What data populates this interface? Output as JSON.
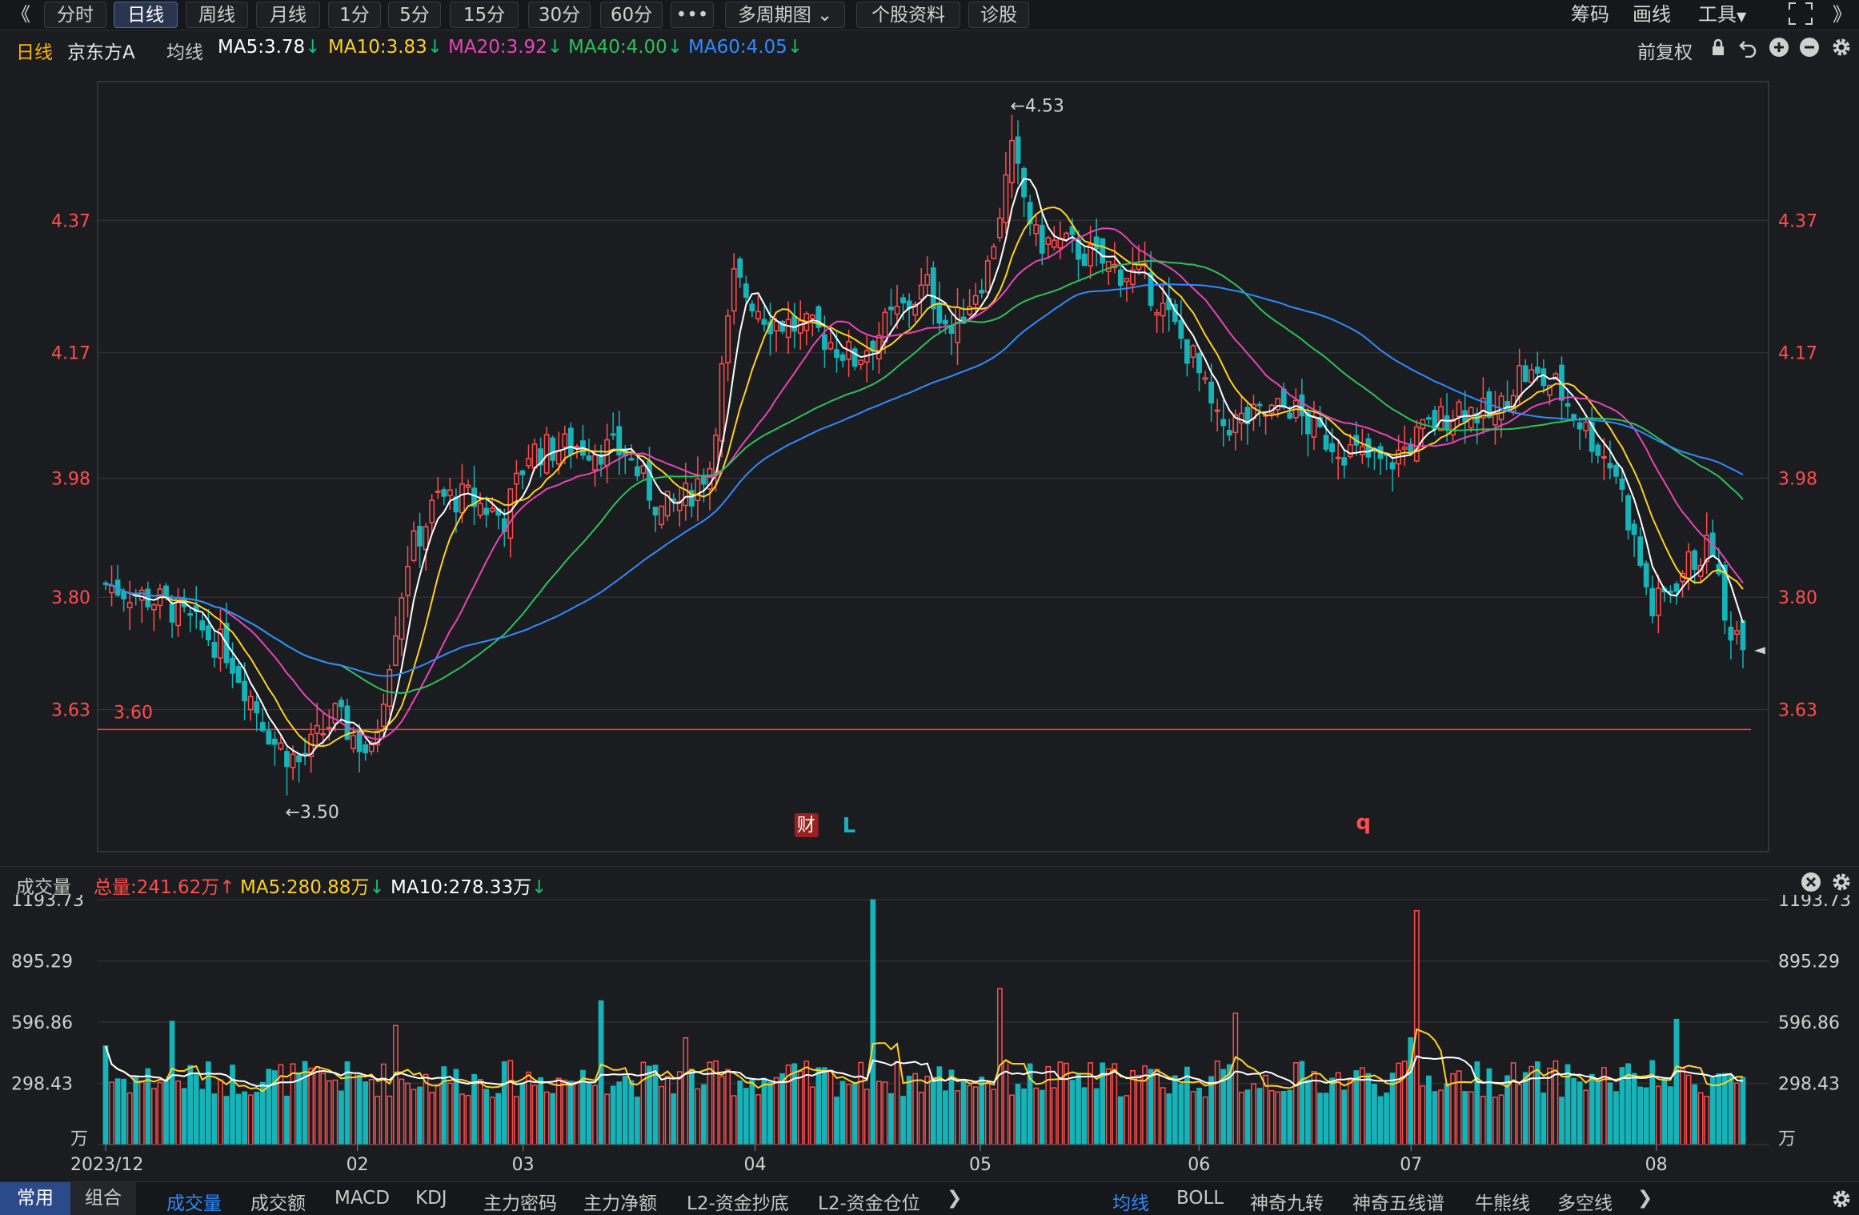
{
  "toolbar": {
    "collapse_label": "《",
    "periods": [
      "分时",
      "日线",
      "周线",
      "月线",
      "1分",
      "5分",
      "15分",
      "30分",
      "60分",
      "•••"
    ],
    "active_period": "日线",
    "multi_period": "多周期图",
    "stock_info": "个股资料",
    "diagnose": "诊股",
    "right": [
      "筹码",
      "画线",
      "工具"
    ],
    "expand_icon": "fullscreen-icon",
    "more_label": "》"
  },
  "info": {
    "period": "日线",
    "stock_name": "京东方A",
    "ma_type": "均线",
    "ma5": "MA5:3.78",
    "ma10": "MA10:3.83",
    "ma20": "MA20:3.92",
    "ma40": "MA40:4.00",
    "ma60": "MA60:4.05",
    "adjust": "前复权"
  },
  "colors": {
    "up": "#ff4d4d",
    "down": "#16b3b8",
    "ma5": "#ffffff",
    "ma10": "#ffd21f",
    "ma20": "#e844b8",
    "ma40": "#2bc25a",
    "ma60": "#2d8cff",
    "arrow_green": "#12c46f"
  },
  "chart": {
    "price_ticks": [
      "4.37",
      "4.17",
      "3.98",
      "3.80",
      "3.63"
    ],
    "price_tick_values": [
      4.37,
      4.17,
      3.98,
      3.8,
      3.63
    ],
    "price_range": [
      3.42,
      4.58
    ],
    "high_label": "←4.53",
    "low_label": "←3.50",
    "level_line_label": "3.60",
    "level_line_value": 3.6,
    "markers": [
      "财",
      "L",
      "q"
    ],
    "marker_days": [
      116,
      123,
      208
    ],
    "high_day": 150,
    "low_day": 30,
    "last_price_marker": "◄",
    "days": 248
  },
  "volume": {
    "label": "成交量",
    "total": "总量:241.62万",
    "ma5": "MA5:280.88万",
    "ma10": "MA10:278.33万",
    "ticks": [
      "1193.73",
      "895.29",
      "596.86",
      "298.43"
    ],
    "tick_values": [
      1193.73,
      895.29,
      596.86,
      298.43
    ],
    "unit": "万",
    "range": [
      0,
      1193.73
    ]
  },
  "x_labels": [
    "2023/12",
    "02",
    "03",
    "04",
    "05",
    "06",
    "07",
    "08"
  ],
  "x_label_days": [
    0,
    38,
    63,
    98,
    132,
    165,
    197,
    234
  ],
  "bottom": {
    "tabs_left": [
      "常用",
      "组合"
    ],
    "active_left": "常用",
    "indicators": [
      "成交量",
      "成交额",
      "MACD",
      "KDJ",
      "主力密码",
      "主力净额",
      "L2-资金抄底",
      "L2-资金仓位"
    ],
    "active_indicator": "成交量",
    "overlays": [
      "均线",
      "BOLL",
      "神奇九转",
      "神奇五线谱",
      "牛熊线",
      "多空线"
    ],
    "active_overlay": "均线"
  }
}
